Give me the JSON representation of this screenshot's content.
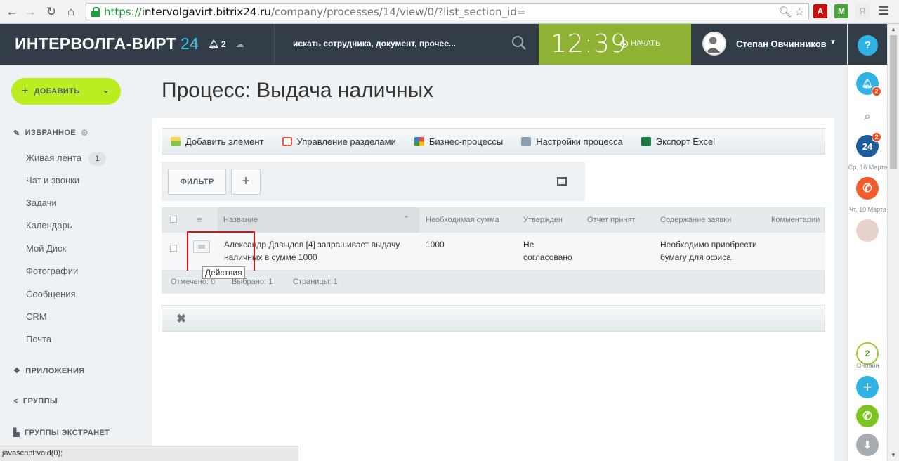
{
  "browser": {
    "url_protocol": "https://",
    "url_host": "intervolgavirt.bitrix24.ru",
    "url_path": "/company/processes/14/view/0/?list_section_id=",
    "status_text": "javascript:void(0);"
  },
  "header": {
    "logo_text": "ИНТЕРВОЛГА-ВИРТ",
    "logo_num": "24",
    "notifications_count": "2",
    "search_placeholder": "искать сотрудника, документ, прочее...",
    "time": "12:39",
    "start_label": "НАЧАТЬ",
    "user_name": "Степан Овчинников",
    "help_label": "?"
  },
  "left_menu": {
    "add_label": "ДОБАВИТЬ",
    "favorites_label": "ИЗБРАННОЕ",
    "items": [
      {
        "label": "Живая лента",
        "count": "1"
      },
      {
        "label": "Чат и звонки"
      },
      {
        "label": "Задачи"
      },
      {
        "label": "Календарь"
      },
      {
        "label": "Мой Диск"
      },
      {
        "label": "Фотографии"
      },
      {
        "label": "Сообщения"
      },
      {
        "label": "CRM"
      },
      {
        "label": "Почта"
      }
    ],
    "apps_label": "ПРИЛОЖЕНИЯ",
    "groups_label": "ГРУППЫ",
    "extranet_label": "ГРУППЫ ЭКСТРАНЕТ"
  },
  "right_bar": {
    "notif_badge": "2",
    "b24_badge": "2",
    "date1": "Ср, 16 Марта",
    "date2": "Чт, 10 Марта",
    "online_count": "2",
    "online_label": "Онлайн"
  },
  "page": {
    "title": "Процесс: Выдача наличных"
  },
  "toolbar": {
    "add_element": "Добавить элемент",
    "manage_sections": "Управление разделами",
    "business_processes": "Бизнес-процессы",
    "process_settings": "Настройки процесса",
    "export_excel": "Экспорт Excel"
  },
  "filter": {
    "filter_label": "ФИЛЬТР",
    "add_label": "+"
  },
  "grid": {
    "columns": [
      "Название",
      "Необходимая сумма",
      "Утвержден",
      "Отчет принят",
      "Содержание заявки",
      "Комментарии"
    ],
    "rows": [
      {
        "name_line1": "Александр Давыдов [4] запрашивает выдачу",
        "name_line2": "наличных в сумме 1000",
        "amount": "1000",
        "approved_line1": "Не",
        "approved_line2": "согласовано",
        "report": "",
        "content_line1": "Необходимо приобрести",
        "content_line2": "бумагу для офиса",
        "comments": ""
      }
    ],
    "tooltip": "Действия",
    "footer": {
      "checked": "Отмечено: 0",
      "selected": "Выбрано: 1",
      "pages": "Страницы:  1"
    }
  },
  "colors": {
    "header_bg": "#333d47",
    "time_bg": "#8fb134",
    "add_btn": "#bbed21",
    "highlight": "#e21111",
    "accent_blue": "#2fc6f6"
  }
}
